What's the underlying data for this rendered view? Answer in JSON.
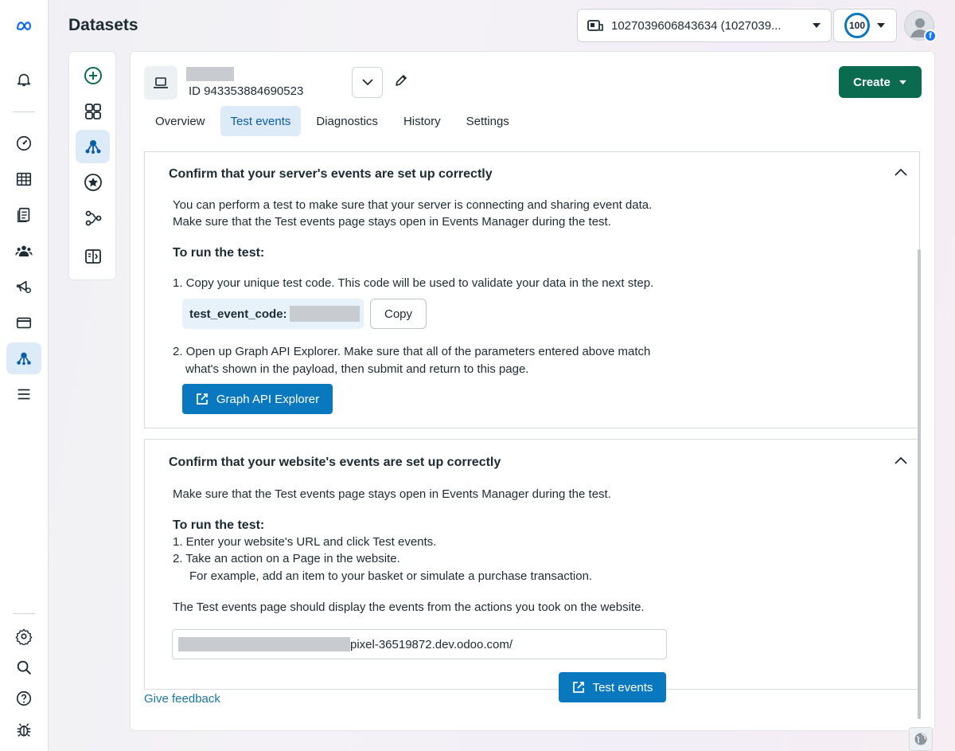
{
  "app": {
    "title": "Datasets"
  },
  "header": {
    "account_selector": "1027039606843634 (1027039...",
    "score": "100"
  },
  "dataset": {
    "id_text": "ID 943353884690523",
    "create_label": "Create"
  },
  "tabs": [
    {
      "label": "Overview",
      "active": false
    },
    {
      "label": "Test events",
      "active": true
    },
    {
      "label": "Diagnostics",
      "active": false
    },
    {
      "label": "History",
      "active": false
    },
    {
      "label": "Settings",
      "active": false
    }
  ],
  "server_section": {
    "title": "Confirm that your server's events are set up correctly",
    "intro_line1": "You can perform a test to make sure that your server is connecting and sharing event data.",
    "intro_line2": "Make sure that the Test events page stays open in Events Manager during the test.",
    "run_heading": "To run the test:",
    "step1": "1.  Copy your unique test code. This code will be used to validate your data in the next step.",
    "code_label": "test_event_code:",
    "copy_label": "Copy",
    "step2_line1": "2. Open up Graph API Explorer. Make sure that all of the parameters entered above match",
    "step2_line2": "what's shown in the payload, then submit and return to this page.",
    "graph_button": "Graph API Explorer"
  },
  "website_section": {
    "title": "Confirm that your website's events are set up correctly",
    "intro": "Make sure that the Test events page stays open in Events Manager during the test.",
    "run_heading": "To run the test:",
    "step1": "1.  Enter your website's URL and click Test events.",
    "step2_line1": "2.  Take an action on a Page in the website.",
    "step2_line2": "For example, add an item to your basket or simulate a purchase transaction.",
    "result_text": "The Test events page should display the events from the actions you took on the website.",
    "url_value": "pixel-36519872.dev.odoo.com/",
    "test_button": "Test events"
  },
  "feedback_link": "Give feedback",
  "colors": {
    "primary_blue": "#0a78be",
    "create_green": "#0b6b4f",
    "active_tab_bg": "#dcebf7",
    "meta_blue": "#0866ff"
  },
  "icons": {
    "left_nav": [
      "meta-logo-icon",
      "bell-icon",
      "gauge-icon",
      "table-icon",
      "document-list-icon",
      "audience-icon",
      "campaign-settings-icon",
      "billing-card-icon",
      "events-manager-icon",
      "menu-icon",
      "gear-icon",
      "search-icon",
      "help-icon",
      "bug-icon"
    ],
    "sub_nav": [
      "add-circle-icon",
      "overview-grid-icon",
      "datasets-icon",
      "star-circle-icon",
      "connections-icon",
      "partner-integration-icon"
    ]
  }
}
